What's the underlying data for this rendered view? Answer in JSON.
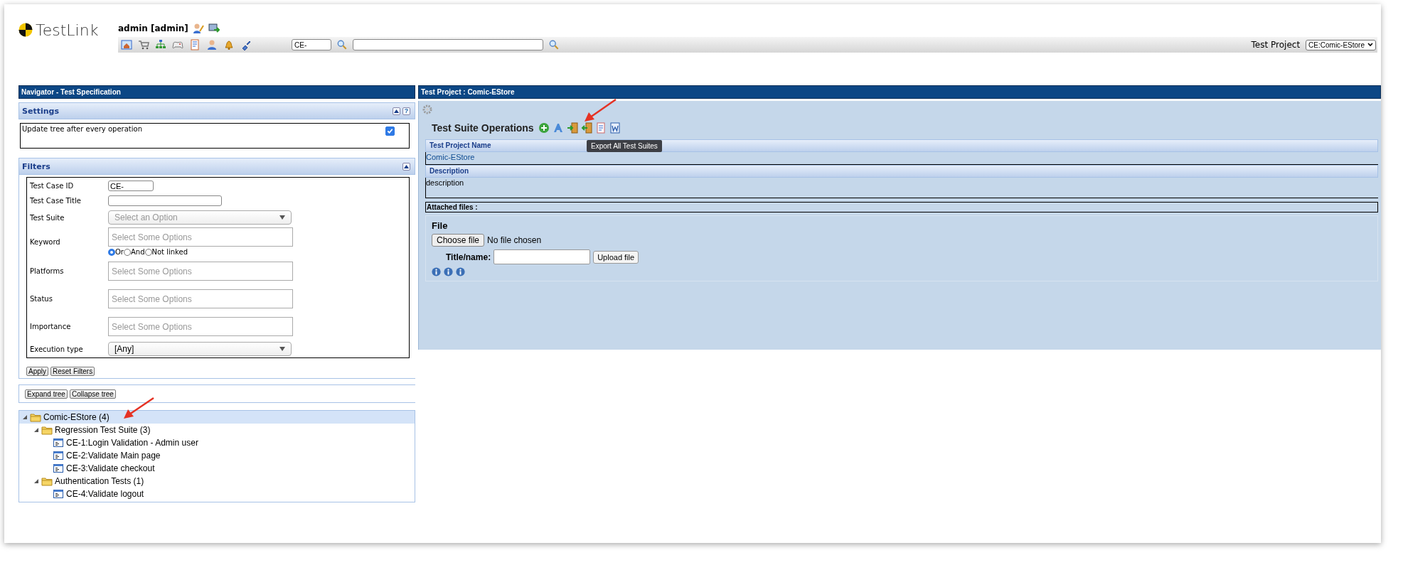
{
  "header": {
    "logo": "TestLink",
    "user": "admin [admin]",
    "search_id": "CE-",
    "project_label": "Test Project",
    "project_select": "CE:Comic-EStore"
  },
  "navigator": {
    "title": "Navigator - Test Specification",
    "settings": {
      "title": "Settings",
      "help_button": "?",
      "options": [
        {
          "label": "Update tree after every operation",
          "checked": true
        }
      ]
    },
    "filters": {
      "title": "Filters",
      "fields": [
        {
          "label": "Test Case ID",
          "kind": "short",
          "value": "CE-"
        },
        {
          "label": "Test Case Title",
          "kind": "text"
        },
        {
          "label": "Test Suite",
          "kind": "select",
          "placeholder": "Select an Option"
        },
        {
          "label": "Keyword",
          "kind": "multi",
          "placeholder": "Select Some Options",
          "modes": [
            {
              "label": "Or",
              "selected": true
            },
            {
              "label": "And",
              "selected": false
            },
            {
              "label": "Not linked",
              "selected": false
            }
          ]
        },
        {
          "label": "Platforms",
          "kind": "multi",
          "placeholder": "Select Some Options"
        },
        {
          "label": "Status",
          "kind": "multi",
          "placeholder": "Select Some Options"
        },
        {
          "label": "Importance",
          "kind": "multi",
          "placeholder": "Select Some Options"
        },
        {
          "label": "Execution type",
          "kind": "select",
          "value": "[Any]"
        }
      ],
      "buttons": [
        "Apply",
        "Reset Filters"
      ]
    },
    "tree_buttons": [
      "Expand tree",
      "Collapse tree"
    ],
    "tree": [
      {
        "label": "Comic-EStore (4)",
        "kind": "folder",
        "expanded": true,
        "selected": true,
        "children": [
          {
            "label": "Regression Test Suite (3)",
            "kind": "folder",
            "expanded": true,
            "selected": false,
            "children": [
              {
                "label": "CE-1:Login Validation - Admin user",
                "kind": "case",
                "selected": false
              },
              {
                "label": "CE-2:Validate Main page",
                "kind": "case",
                "selected": false
              },
              {
                "label": "CE-3:Validate checkout",
                "kind": "case",
                "selected": false
              }
            ]
          },
          {
            "label": "Authentication Tests (1)",
            "kind": "folder",
            "expanded": true,
            "selected": false,
            "children": [
              {
                "label": "CE-4:Validate logout",
                "kind": "case",
                "selected": false
              }
            ]
          }
        ]
      }
    ]
  },
  "main": {
    "title": "Test Project : Comic-EStore",
    "operations_title": "Test Suite Operations",
    "tooltip": "Export All Test Suites",
    "fields": [
      {
        "label": "Test Project Name",
        "value": "Comic-EStore",
        "kind": "link"
      },
      {
        "label": "Description",
        "value": "description",
        "kind": "text"
      }
    ],
    "attachments": {
      "title": "Attached files :",
      "file_label": "File",
      "choose_button": "Choose file",
      "file_status": "No file chosen",
      "name_label": "Title/name:",
      "upload_button": "Upload file"
    }
  }
}
